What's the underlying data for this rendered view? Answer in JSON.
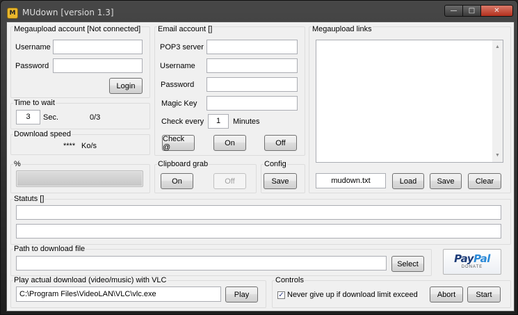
{
  "window": {
    "title": "MUdown [version 1.3]",
    "icon_letter": "M",
    "controls": {
      "minimize": "—",
      "maximize": "□",
      "close": "✕"
    }
  },
  "account": {
    "group_title": "Megaupload account [Not connected]",
    "username_label": "Username",
    "password_label": "Password",
    "username_value": "",
    "password_value": "",
    "login_button": "Login"
  },
  "wait": {
    "group_title": "Time to wait",
    "seconds_value": "3",
    "seconds_unit": "Sec.",
    "counter": "0/3"
  },
  "speed": {
    "group_title": "Download speed",
    "value": "****",
    "unit": "Ko/s"
  },
  "progress": {
    "group_title": "%",
    "fraction": 1.0
  },
  "email": {
    "group_title": "Email account []",
    "pop3_label": "POP3 server",
    "username_label": "Username",
    "password_label": "Password",
    "magic_key_label": "Magic Key",
    "check_every_label": "Check every",
    "check_every_value": "1",
    "minutes_label": "Minutes",
    "check_button": "Check @",
    "on_button": "On",
    "off_button": "Off"
  },
  "clipboard": {
    "group_title": "Clipboard grab",
    "on_button": "On",
    "off_button": "Off"
  },
  "config": {
    "group_title": "Config",
    "save_button": "Save"
  },
  "links": {
    "group_title": "Megaupload links",
    "file_value": "mudown.txt",
    "load_button": "Load",
    "save_button": "Save",
    "clear_button": "Clear"
  },
  "status": {
    "group_title": "Statuts []",
    "line1": "",
    "line2": ""
  },
  "path": {
    "group_title": "Path to download file",
    "value": "",
    "select_button": "Select"
  },
  "paypal": {
    "brand_pay": "Pay",
    "brand_pal": "Pal",
    "donate": "DONATE"
  },
  "vlc": {
    "group_title": "Play actual download (video/music) with VLC",
    "path_value": "C:\\Program Files\\VideoLAN\\VLC\\vlc.exe",
    "play_button": "Play"
  },
  "controls": {
    "group_title": "Controls",
    "never_give_up_label": "Never give up if download limit exceed",
    "never_give_up_checked": true,
    "check_mark": "✓",
    "abort_button": "Abort",
    "start_button": "Start"
  }
}
